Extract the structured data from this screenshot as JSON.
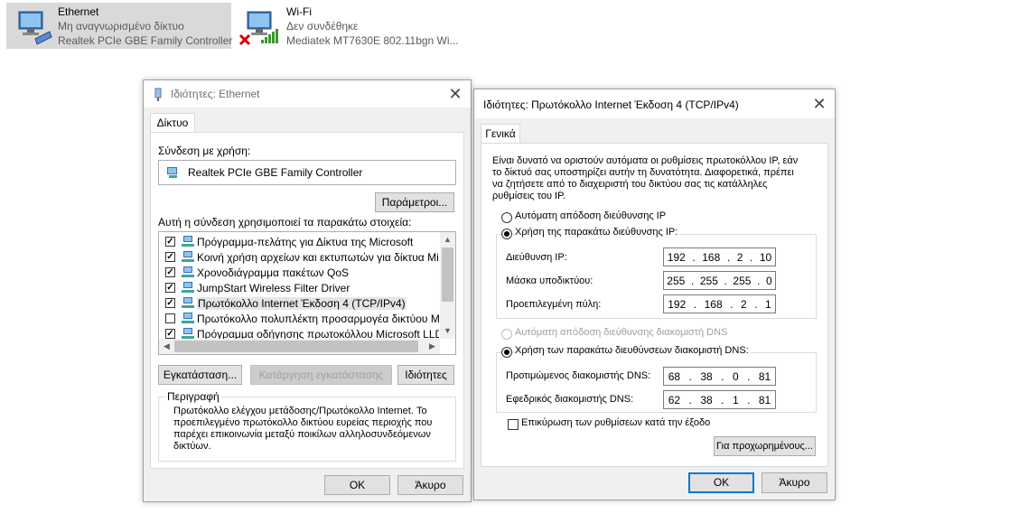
{
  "adapters": [
    {
      "name": "Ethernet",
      "status": "Μη αναγνωρισμένο δίκτυο",
      "device": "Realtek PCIe GBE Family Controller"
    },
    {
      "name": "Wi-Fi",
      "status": "Δεν συνδέθηκε",
      "device": "Mediatek MT7630E 802.11bgn Wi..."
    }
  ],
  "eth_dialog": {
    "title": "Ιδιότητες: Ethernet",
    "tab": "Δίκτυο",
    "connect_using_label": "Σύνδεση με χρήση:",
    "adapter_name": "Realtek PCIe GBE Family Controller",
    "configure_button": "Παράμετροι...",
    "items_label": "Αυτή η σύνδεση χρησιμοποιεί τα παρακάτω στοιχεία:",
    "items": [
      {
        "label": "Πρόγραμμα-πελάτης για Δίκτυα της Microsoft",
        "checked": true
      },
      {
        "label": "Κοινή χρήση αρχείων και εκτυπωτών για δίκτυα Micro",
        "checked": true
      },
      {
        "label": "Χρονοδιάγραμμα πακέτων QoS",
        "checked": true
      },
      {
        "label": "JumpStart Wireless Filter Driver",
        "checked": true
      },
      {
        "label": "Πρωτόκολλο Internet Έκδοση 4 (TCP/IPv4)",
        "checked": true
      },
      {
        "label": "Πρωτόκολλο πολυπλέκτη προσαρμογέα δικτύου Micros",
        "checked": false
      },
      {
        "label": "Πρόγραμμα οδήγησης πρωτοκόλλου Microsoft LLDP",
        "checked": true
      }
    ],
    "install_button": "Εγκατάσταση...",
    "uninstall_button": "Κατάργηση εγκατάστασης",
    "properties_button": "Ιδιότητες",
    "description_label": "Περιγραφή",
    "description_text": "Πρωτόκολλο ελέγχου μετάδοσης/Πρωτόκολλο Internet. Το προεπιλεγμένο πρωτόκολλο δικτύου ευρείας περιοχής που παρέχει επικοινωνία μεταξύ ποικίλων αλληλοσυνδεόμενων δικτύων.",
    "ok_button": "OK",
    "cancel_button": "Άκυρο"
  },
  "ipv4_dialog": {
    "title": "Ιδιότητες: Πρωτόκολλο Internet Έκδοση 4 (TCP/IPv4)",
    "tab": "Γενικά",
    "intro": "Είναι δυνατό να οριστούν αυτόματα οι ρυθμίσεις πρωτοκόλλου IP, εάν το δίκτυό σας υποστηρίζει αυτήν τη δυνατότητα. Διαφορετικά, πρέπει να ζητήσετε από το διαχειριστή του δικτύου σας τις κατάλληλες ρυθμίσεις του IP.",
    "auto_ip_label": "Αυτόματη απόδοση διεύθυνσης IP",
    "manual_ip_label": "Χρήση της παρακάτω διεύθυνσης IP:",
    "ip_address_label": "Διεύθυνση IP:",
    "ip_address": [
      "192",
      "168",
      "2",
      "10"
    ],
    "subnet_label": "Μάσκα υποδικτύου:",
    "subnet": [
      "255",
      "255",
      "255",
      "0"
    ],
    "gateway_label": "Προεπιλεγμένη πύλη:",
    "gateway": [
      "192",
      "168",
      "2",
      "1"
    ],
    "auto_dns_label": "Αυτόματη απόδοση διεύθυνσης διακομιστή DNS",
    "manual_dns_label": "Χρήση των παρακάτω διευθύνσεων διακομιστή DNS:",
    "preferred_dns_label": "Προτιμώμενος διακομιστής DNS:",
    "preferred_dns": [
      "68",
      "38",
      "0",
      "81"
    ],
    "alternate_dns_label": "Εφεδρικός διακομιστής DNS:",
    "alternate_dns": [
      "62",
      "38",
      "1",
      "81"
    ],
    "validate_label": "Επικύρωση των ρυθμίσεων κατά την έξοδο",
    "advanced_button": "Για προχωρημένους...",
    "ok_button": "OK",
    "cancel_button": "Άκυρο"
  },
  "colors": {
    "selected_adapter_bg": "#d9d9d9",
    "accent": "#0078d7",
    "disconnected_x": "#d40000"
  }
}
